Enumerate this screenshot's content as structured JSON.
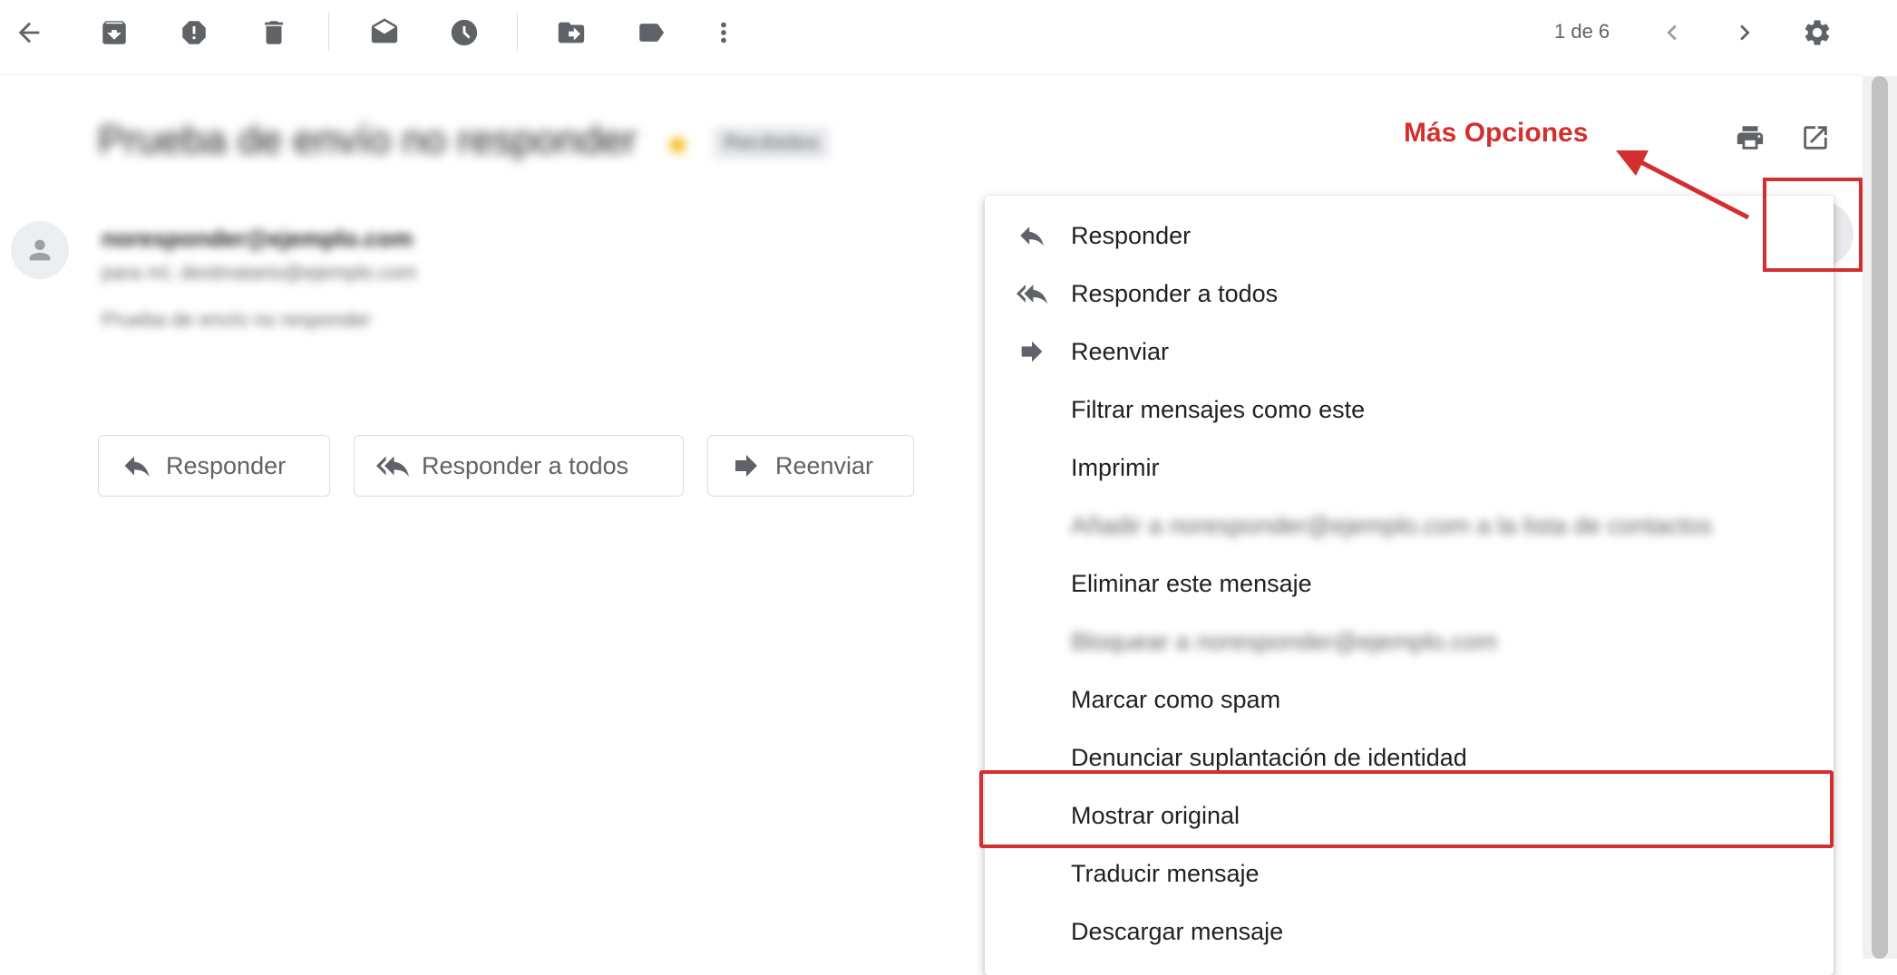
{
  "toolbar": {
    "icons": [
      "back-arrow-icon",
      "archive-icon",
      "report-spam-icon",
      "trash-icon",
      "mark-unread-icon",
      "snooze-icon",
      "move-to-icon",
      "label-icon",
      "more-vertical-icon"
    ],
    "pager": "1 de 6",
    "nav": [
      "chevron-left-icon",
      "chevron-right-icon"
    ],
    "settings_icon": "gear-icon"
  },
  "email": {
    "subject": "Prueba de envío no responder",
    "label": "Recibidos",
    "sender": "noresponder@ejemplo.com",
    "recipient": "para mí, destinatario@ejemplo.com",
    "snippet": "Prueba de envío no responder"
  },
  "actions": {
    "reply": "Responder",
    "reply_all": "Responder a todos",
    "forward": "Reenviar"
  },
  "annotation": {
    "text": "Más Opciones",
    "color": "#d32f2f"
  },
  "menu": {
    "items": [
      {
        "label": "Responder",
        "icon": "reply-icon"
      },
      {
        "label": "Responder a todos",
        "icon": "reply-all-icon"
      },
      {
        "label": "Reenviar",
        "icon": "forward-icon"
      },
      {
        "label": "Filtrar mensajes como este",
        "icon": ""
      },
      {
        "label": "Imprimir",
        "icon": ""
      },
      {
        "label": "Añadir a noresponder@ejemplo.com a la lista de contactos",
        "icon": "",
        "blurred": true
      },
      {
        "label": "Eliminar este mensaje",
        "icon": ""
      },
      {
        "label": "Bloquear a noresponder@ejemplo.com",
        "icon": "",
        "blurred": true
      },
      {
        "label": "Marcar como spam",
        "icon": ""
      },
      {
        "label": "Denunciar suplantación de identidad",
        "icon": ""
      },
      {
        "label": "Mostrar original",
        "icon": "",
        "highlighted": true
      },
      {
        "label": "Traducir mensaje",
        "icon": ""
      },
      {
        "label": "Descargar mensaje",
        "icon": ""
      }
    ]
  }
}
